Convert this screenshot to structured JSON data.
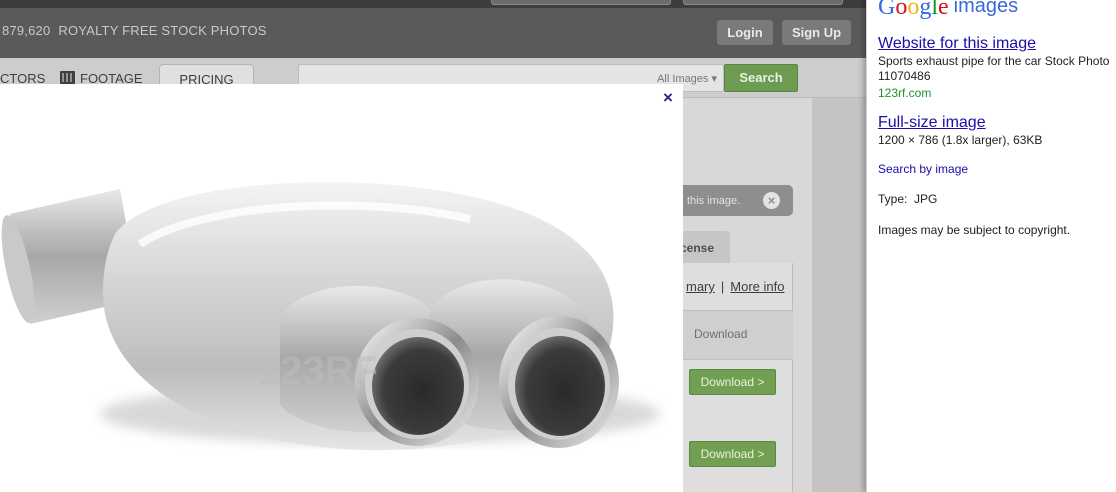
{
  "site": {
    "header": {
      "photo_count": "879,620",
      "tagline": "ROYALTY FREE STOCK PHOTOS",
      "login_label": "Login",
      "signup_label": "Sign Up"
    },
    "nav": {
      "vectors_label": "CTORS",
      "footage_label": "FOOTAGE",
      "pricing_label": "PRICING"
    },
    "search": {
      "scope_label": "All Images ▾",
      "button_label": "Search"
    },
    "banner": {
      "text": "this image.",
      "close_glyph": "×"
    },
    "license_tab_label": "cense",
    "info_links": {
      "summary_label": "mary",
      "separator": "|",
      "more_info_label": "More info"
    },
    "download_header": "Download",
    "download_buttons": [
      "Download >",
      "Download >"
    ]
  },
  "lightbox": {
    "close_glyph": "×",
    "watermark_text": "123RF"
  },
  "google_panel": {
    "logo_letters": [
      "G",
      "o",
      "o",
      "g",
      "l",
      "e"
    ],
    "logo_word": "images",
    "website_link_label": "Website for this image",
    "image_title": "Sports exhaust pipe for the car Stock Photo",
    "image_id": "11070486",
    "source_domain": "123rf.com",
    "full_size_label": "Full-size image",
    "full_size_details": "1200 × 786 (1.8x larger), 63KB",
    "search_by_image_label": "Search by image",
    "type_label": "Type:",
    "type_value": "JPG",
    "copyright_notice": "Images may be subject to copyright."
  },
  "colors": {
    "google_link": "#1a0dab",
    "google_green": "#26902d",
    "search_green": "#6e9b52",
    "close_x": "#23238e"
  }
}
